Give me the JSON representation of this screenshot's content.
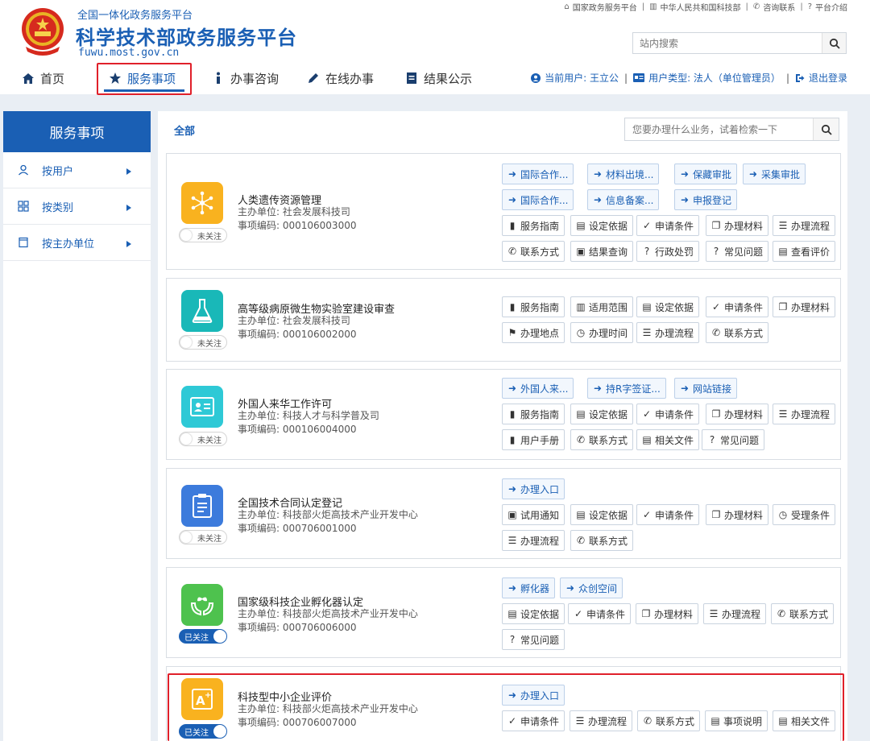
{
  "site": {
    "subtitle": "全国一体化政务服务平台",
    "title": "科学技术部政务服务平台",
    "url": "fuwu.most.gov.cn"
  },
  "top_links": [
    "国家政务服务平台",
    "中华人民共和国科技部",
    "咨询联系",
    "平台介绍"
  ],
  "top_search": {
    "placeholder": "站内搜索"
  },
  "nav": [
    "首页",
    "服务事项",
    "办事咨询",
    "在线办事",
    "结果公示"
  ],
  "user": {
    "current_label": "当前用户: 王立公",
    "type_label": "用户类型: 法人（单位管理员）",
    "logout": "退出登录"
  },
  "sidebar": {
    "title": "服务事项",
    "items": [
      "按用户",
      "按类别",
      "按主办单位"
    ]
  },
  "main": {
    "tab": "全部",
    "search_placeholder": "您要办理什么业务，试着检索一下"
  },
  "cards": [
    {
      "title": "人类遗传资源管理",
      "unit": "主办单位: 社会发展科技司",
      "code": "事项编码: 000106003000",
      "follow": "未关注",
      "links": [
        "国际合作...",
        "材料出境...",
        "保藏审批",
        "采集审批",
        "国际合作...",
        "信息备案...",
        "申报登记"
      ],
      "actions": [
        "服务指南",
        "设定依据",
        "申请条件",
        "办理材料",
        "办理流程",
        "联系方式",
        "结果查询",
        "行政处罚",
        "常见问题",
        "查看评价"
      ]
    },
    {
      "title": "高等级病原微生物实验室建设审查",
      "unit": "主办单位: 社会发展科技司",
      "code": "事项编码: 000106002000",
      "follow": "未关注",
      "links": [],
      "actions": [
        "服务指南",
        "适用范围",
        "设定依据",
        "申请条件",
        "办理材料",
        "办理地点",
        "办理时间",
        "办理流程",
        "联系方式"
      ]
    },
    {
      "title": "外国人来华工作许可",
      "unit": "主办单位: 科技人才与科学普及司",
      "code": "事项编码: 000106004000",
      "follow": "未关注",
      "links": [
        "外国人来...",
        "持R字签证...",
        "网站链接"
      ],
      "actions": [
        "服务指南",
        "设定依据",
        "申请条件",
        "办理材料",
        "办理流程",
        "用户手册",
        "联系方式",
        "相关文件",
        "常见问题"
      ]
    },
    {
      "title": "全国技术合同认定登记",
      "unit": "主办单位: 科技部火炬高技术产业开发中心",
      "code": "事项编码: 000706001000",
      "follow": "未关注",
      "links": [
        "办理入口"
      ],
      "actions": [
        "试用通知",
        "设定依据",
        "申请条件",
        "办理材料",
        "受理条件",
        "办理流程",
        "联系方式"
      ]
    },
    {
      "title": "国家级科技企业孵化器认定",
      "unit": "主办单位: 科技部火炬高技术产业开发中心",
      "code": "事项编码: 000706006000",
      "follow": "已关注",
      "links": [
        "孵化器",
        "众创空间"
      ],
      "actions": [
        "设定依据",
        "申请条件",
        "办理材料",
        "办理流程",
        "联系方式",
        "常见问题"
      ]
    },
    {
      "title": "科技型中小企业评价",
      "unit": "主办单位: 科技部火炬高技术产业开发中心",
      "code": "事项编码: 000706007000",
      "follow": "已关注",
      "links": [
        "办理入口"
      ],
      "actions": [
        "申请条件",
        "办理流程",
        "联系方式",
        "事项说明",
        "相关文件"
      ]
    }
  ],
  "colors": {
    "brand_blue": "#1a5fb4",
    "highlight_red": "#e0202a",
    "icon_orange": "#f9b21f",
    "icon_teal": "#19b8b8",
    "icon_cyan": "#2ec9d6",
    "icon_blue": "#3c7bdc",
    "icon_green": "#4ec24e"
  }
}
